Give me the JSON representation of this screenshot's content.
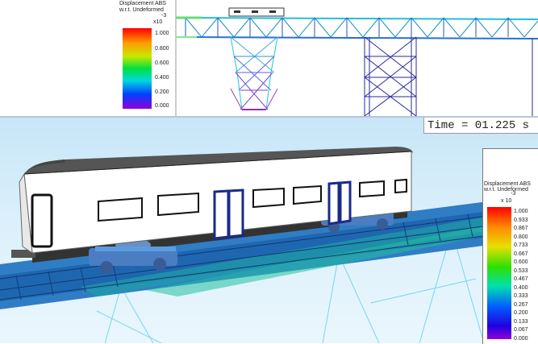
{
  "time": {
    "label": "Time = 01.225 s"
  },
  "legend_top": {
    "title_line1": "Displacement ABS",
    "title_line2": "w.r.t. Undeformed",
    "exponent_base": "x10",
    "exponent_power": "-3",
    "ticks": [
      "1.000",
      "0.800",
      "0.600",
      "0.400",
      "0.200",
      "0.000"
    ]
  },
  "legend_bottom": {
    "title_line1": "Displacement ABS",
    "title_line2": "w.r.t. Undeformed",
    "exponent_base": "x 10",
    "exponent_power": "-3",
    "ticks": [
      "1.000",
      "0.933",
      "0.867",
      "0.800",
      "0.733",
      "0.667",
      "0.600",
      "0.533",
      "0.467",
      "0.400",
      "0.333",
      "0.267",
      "0.200",
      "0.133",
      "0.067",
      "0.000"
    ]
  },
  "colors": {
    "rail_car_body": "#ffffff",
    "rail_car_roof": "#555555",
    "door_frame": "#1a2a8a",
    "bogie": "#4b7dc2",
    "track_deck": "#1f6fbf"
  }
}
